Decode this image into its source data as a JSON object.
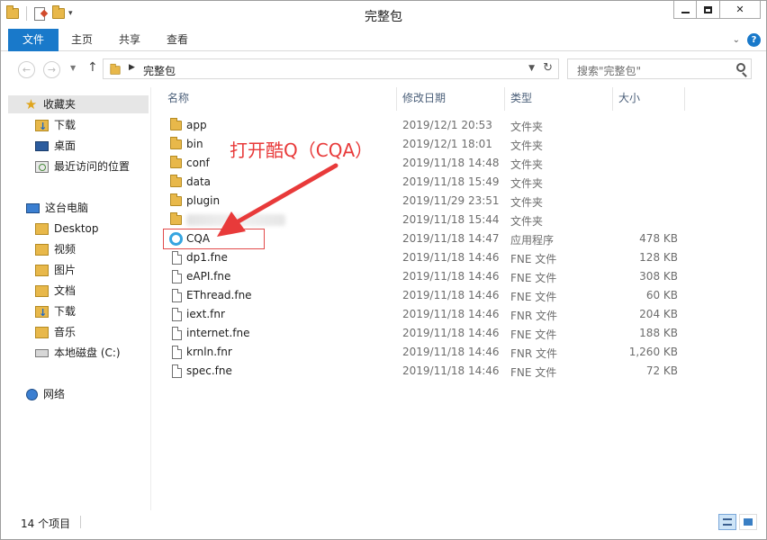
{
  "window": {
    "title": "完整包",
    "controls": {
      "minimize": "minimize",
      "maximize": "maximize",
      "close": "✕"
    }
  },
  "ribbon": {
    "tabs": [
      "文件",
      "主页",
      "共享",
      "查看"
    ],
    "help": "?"
  },
  "navigation": {
    "breadcrumb": "完整包",
    "search_placeholder": "搜索\"完整包\""
  },
  "sidebar": {
    "items": [
      {
        "label": "收藏夹",
        "icon": "star-icon"
      },
      {
        "label": "下载",
        "icon": "downloads-folder-icon"
      },
      {
        "label": "桌面",
        "icon": "desktop-icon"
      },
      {
        "label": "最近访问的位置",
        "icon": "recent-places-icon"
      },
      {
        "label": "这台电脑",
        "icon": "computer-icon"
      },
      {
        "label": "Desktop",
        "icon": "folder-icon"
      },
      {
        "label": "视频",
        "icon": "videos-folder-icon"
      },
      {
        "label": "图片",
        "icon": "pictures-folder-icon"
      },
      {
        "label": "文档",
        "icon": "documents-folder-icon"
      },
      {
        "label": "下载",
        "icon": "downloads-folder-icon"
      },
      {
        "label": "音乐",
        "icon": "music-folder-icon"
      },
      {
        "label": "本地磁盘 (C:)",
        "icon": "drive-icon"
      },
      {
        "label": "网络",
        "icon": "network-icon"
      }
    ]
  },
  "columns": {
    "name": "名称",
    "date": "修改日期",
    "type": "类型",
    "size": "大小"
  },
  "files": [
    {
      "name": "app",
      "date": "2019/12/1 20:53",
      "type": "文件夹",
      "size": "",
      "icon": "folder-icon"
    },
    {
      "name": "bin",
      "date": "2019/12/1 18:01",
      "type": "文件夹",
      "size": "",
      "icon": "folder-icon"
    },
    {
      "name": "conf",
      "date": "2019/11/18 14:48",
      "type": "文件夹",
      "size": "",
      "icon": "folder-icon"
    },
    {
      "name": "data",
      "date": "2019/11/18 15:49",
      "type": "文件夹",
      "size": "",
      "icon": "folder-icon"
    },
    {
      "name": "plugin",
      "date": "2019/11/29 23:51",
      "type": "文件夹",
      "size": "",
      "icon": "folder-icon"
    },
    {
      "name": "",
      "date": "2019/11/18 15:44",
      "type": "文件夹",
      "size": "",
      "icon": "folder-icon",
      "blurred": true
    },
    {
      "name": "CQA",
      "date": "2019/11/18 14:47",
      "type": "应用程序",
      "size": "478 KB",
      "icon": "app-icon"
    },
    {
      "name": "dp1.fne",
      "date": "2019/11/18 14:46",
      "type": "FNE 文件",
      "size": "128 KB",
      "icon": "file-icon"
    },
    {
      "name": "eAPI.fne",
      "date": "2019/11/18 14:46",
      "type": "FNE 文件",
      "size": "308 KB",
      "icon": "file-icon"
    },
    {
      "name": "EThread.fne",
      "date": "2019/11/18 14:46",
      "type": "FNE 文件",
      "size": "60 KB",
      "icon": "file-icon"
    },
    {
      "name": "iext.fnr",
      "date": "2019/11/18 14:46",
      "type": "FNR 文件",
      "size": "204 KB",
      "icon": "file-icon"
    },
    {
      "name": "internet.fne",
      "date": "2019/11/18 14:46",
      "type": "FNE 文件",
      "size": "188 KB",
      "icon": "file-icon"
    },
    {
      "name": "krnln.fnr",
      "date": "2019/11/18 14:46",
      "type": "FNR 文件",
      "size": "1,260 KB",
      "icon": "file-icon"
    },
    {
      "name": "spec.fne",
      "date": "2019/11/18 14:46",
      "type": "FNE 文件",
      "size": "72 KB",
      "icon": "file-icon"
    }
  ],
  "annotation": {
    "text": "打开酷Q（CQA）",
    "color": "#e83a3a"
  },
  "status": {
    "item_count": "14 个项目"
  },
  "colors": {
    "accent": "#1979ca",
    "header_text": "#4c607a",
    "annotation": "#e83a3a"
  }
}
